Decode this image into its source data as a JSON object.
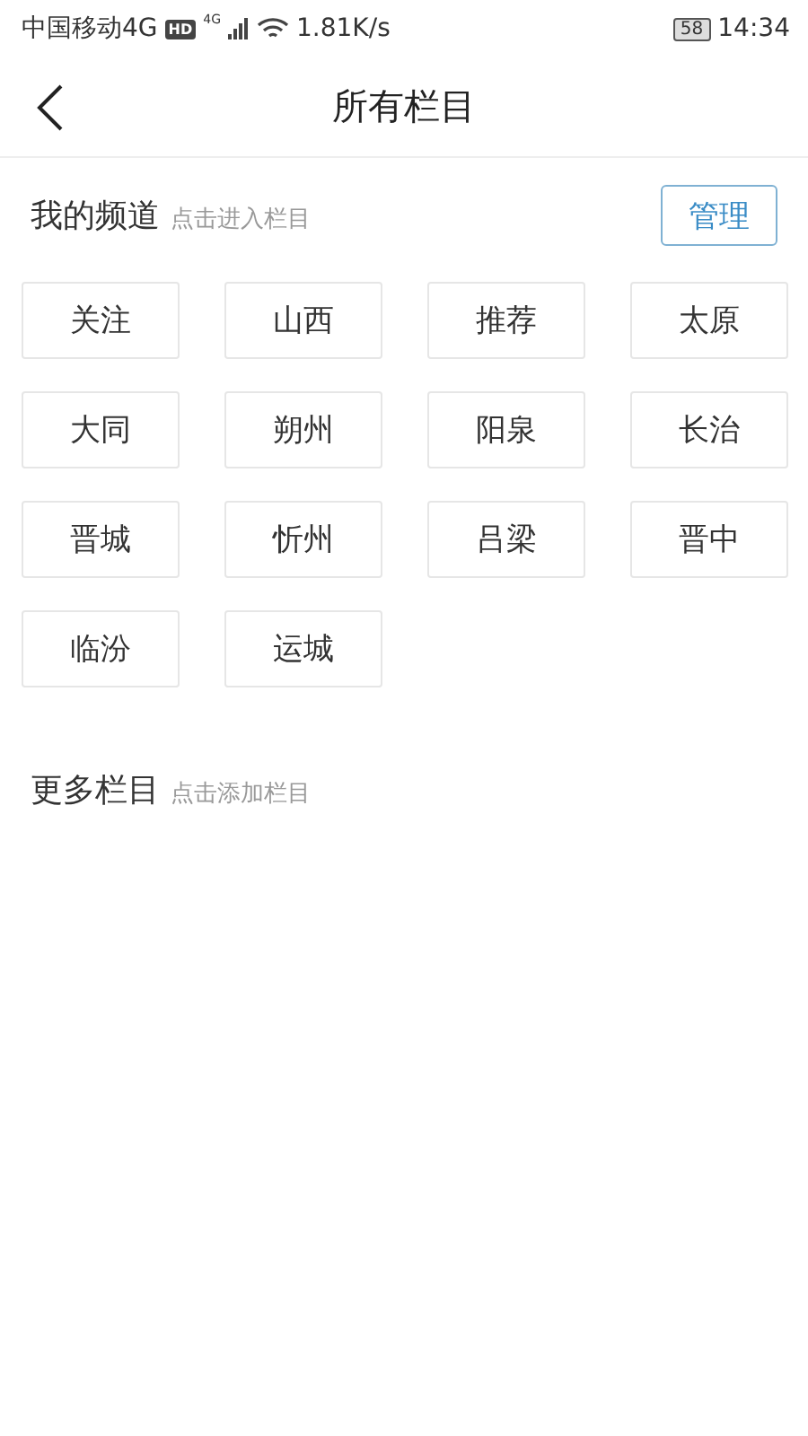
{
  "status_bar": {
    "carrier": "中国移动4G",
    "hd_badge": "HD",
    "network": "4G",
    "speed": "1.81K/s",
    "battery": "58",
    "time": "14:34"
  },
  "header": {
    "title": "所有栏目"
  },
  "my_channels": {
    "title": "我的频道",
    "hint": "点击进入栏目",
    "manage_button": "管理",
    "channels": [
      "关注",
      "山西",
      "推荐",
      "太原",
      "大同",
      "朔州",
      "阳泉",
      "长治",
      "晋城",
      "忻州",
      "吕梁",
      "晋中",
      "临汾",
      "运城"
    ]
  },
  "more_channels": {
    "title": "更多栏目",
    "hint": "点击添加栏目"
  }
}
